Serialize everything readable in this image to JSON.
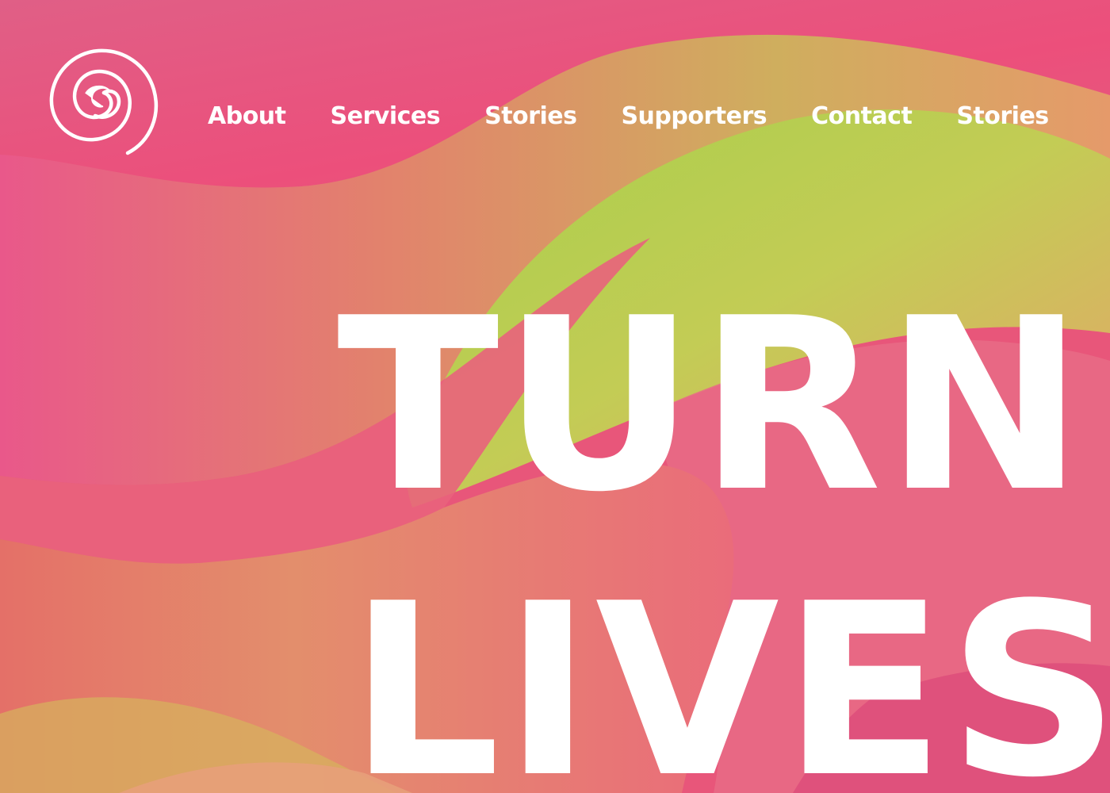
{
  "colors": {
    "base": "#e8567a",
    "pink": "#ea4f7e",
    "salmon": "#e47c6e",
    "peach": "#e39a6c",
    "yellow_green": "#b8cc55",
    "lime": "#a8d04a",
    "text": "#ffffff"
  },
  "logo": {
    "icon": "spiral-icon"
  },
  "nav": {
    "items": [
      {
        "label": "About"
      },
      {
        "label": "Services"
      },
      {
        "label": "Stories"
      },
      {
        "label": "Supporters"
      },
      {
        "label": "Contact"
      },
      {
        "label": "Stories"
      }
    ]
  },
  "hero": {
    "line1": "TURN",
    "line2": "LIVES"
  }
}
